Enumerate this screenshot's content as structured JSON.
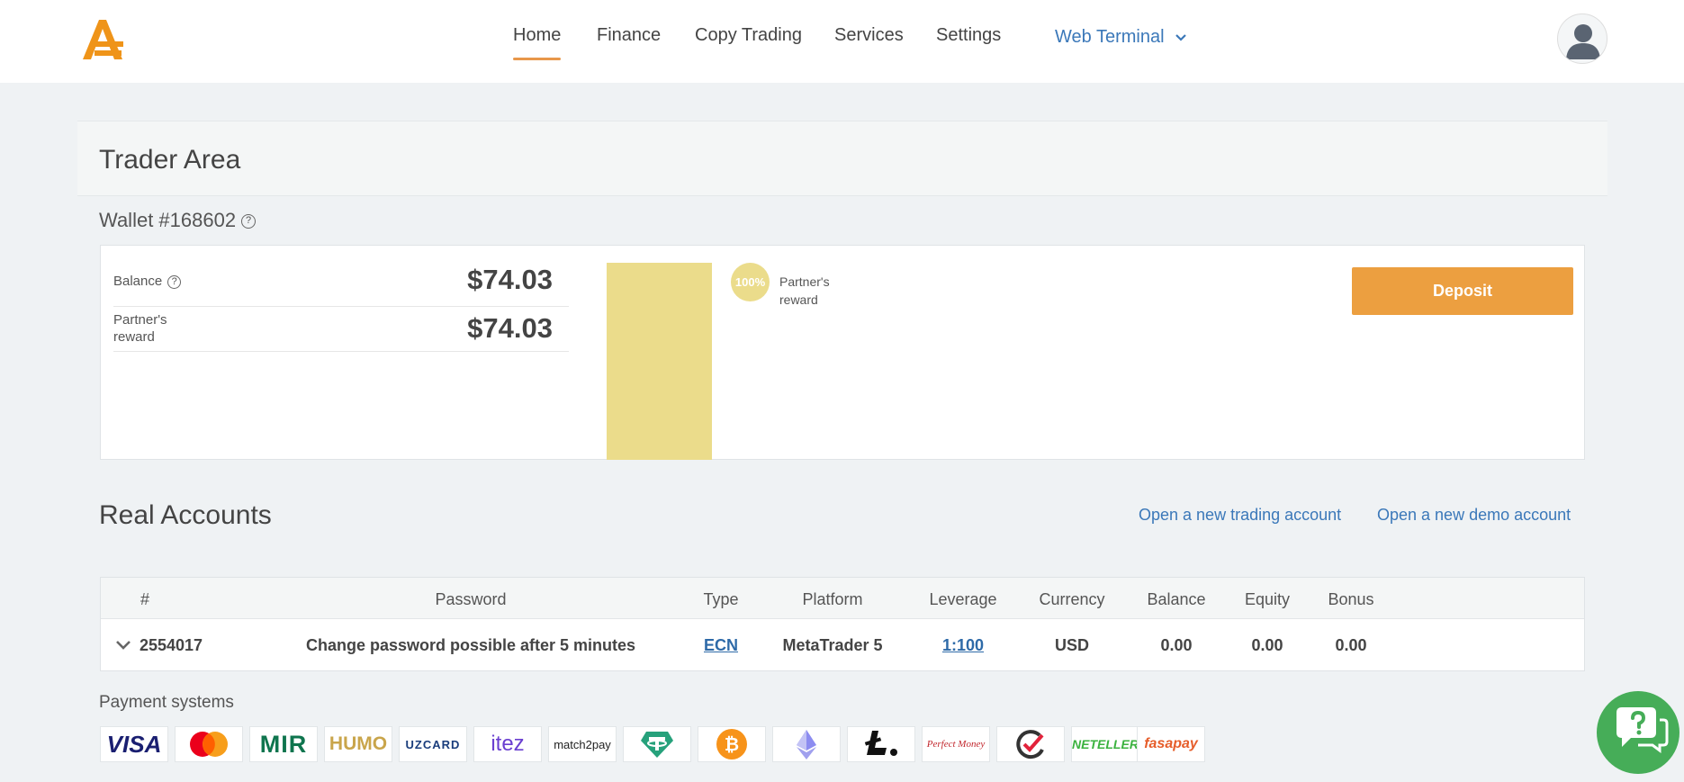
{
  "nav": {
    "items": [
      "Home",
      "Finance",
      "Copy Trading",
      "Services",
      "Settings"
    ],
    "web_terminal": "Web Terminal"
  },
  "trader_area": {
    "title": "Trader Area"
  },
  "wallet": {
    "title": "Wallet #168602",
    "balance_label": "Balance",
    "balance_value": "$74.03",
    "reward_label": "Partner's reward",
    "reward_value": "$74.03",
    "chart": {
      "share_percent": 100,
      "percent_label": "100%",
      "legend_label": "Partner's reward",
      "color": "#ebdc8b"
    },
    "deposit_label": "Deposit"
  },
  "real_accounts": {
    "title": "Real Accounts",
    "open_trading": "Open a new trading account",
    "open_demo": "Open a new demo account",
    "columns": [
      "#",
      "Password",
      "Type",
      "Platform",
      "Leverage",
      "Currency",
      "Balance",
      "Equity",
      "Bonus"
    ],
    "row": {
      "number": "2554017",
      "password": "Change password possible after 5 minutes",
      "type": "ECN",
      "platform": "MetaTrader 5",
      "leverage": "1:100",
      "currency": "USD",
      "balance": "0.00",
      "equity": "0.00",
      "bonus": "0.00"
    }
  },
  "payment": {
    "title": "Payment systems",
    "logos": [
      "VISA",
      "Mastercard",
      "MIR",
      "HUMO",
      "UZCARD",
      "itez",
      "match2pay",
      "Tether",
      "Bitcoin",
      "Ethereum",
      "Litecoin",
      "Perfect Money",
      "Check",
      "NETELLER",
      "fasapay"
    ],
    "logo_text": {
      "visa": "VISA",
      "mir": "MIR",
      "humo": "HUMO",
      "uzcard": "UZCARD",
      "itez": "itez",
      "match2pay": "match2pay",
      "perfect_money": "Perfect Money",
      "neteller": "NETELLER",
      "fasapay": "fasapay"
    }
  },
  "colors": {
    "accent": "#ec9f40",
    "link": "#3b78b9",
    "help": "#46ad58",
    "nav_active": "#e8974a"
  }
}
